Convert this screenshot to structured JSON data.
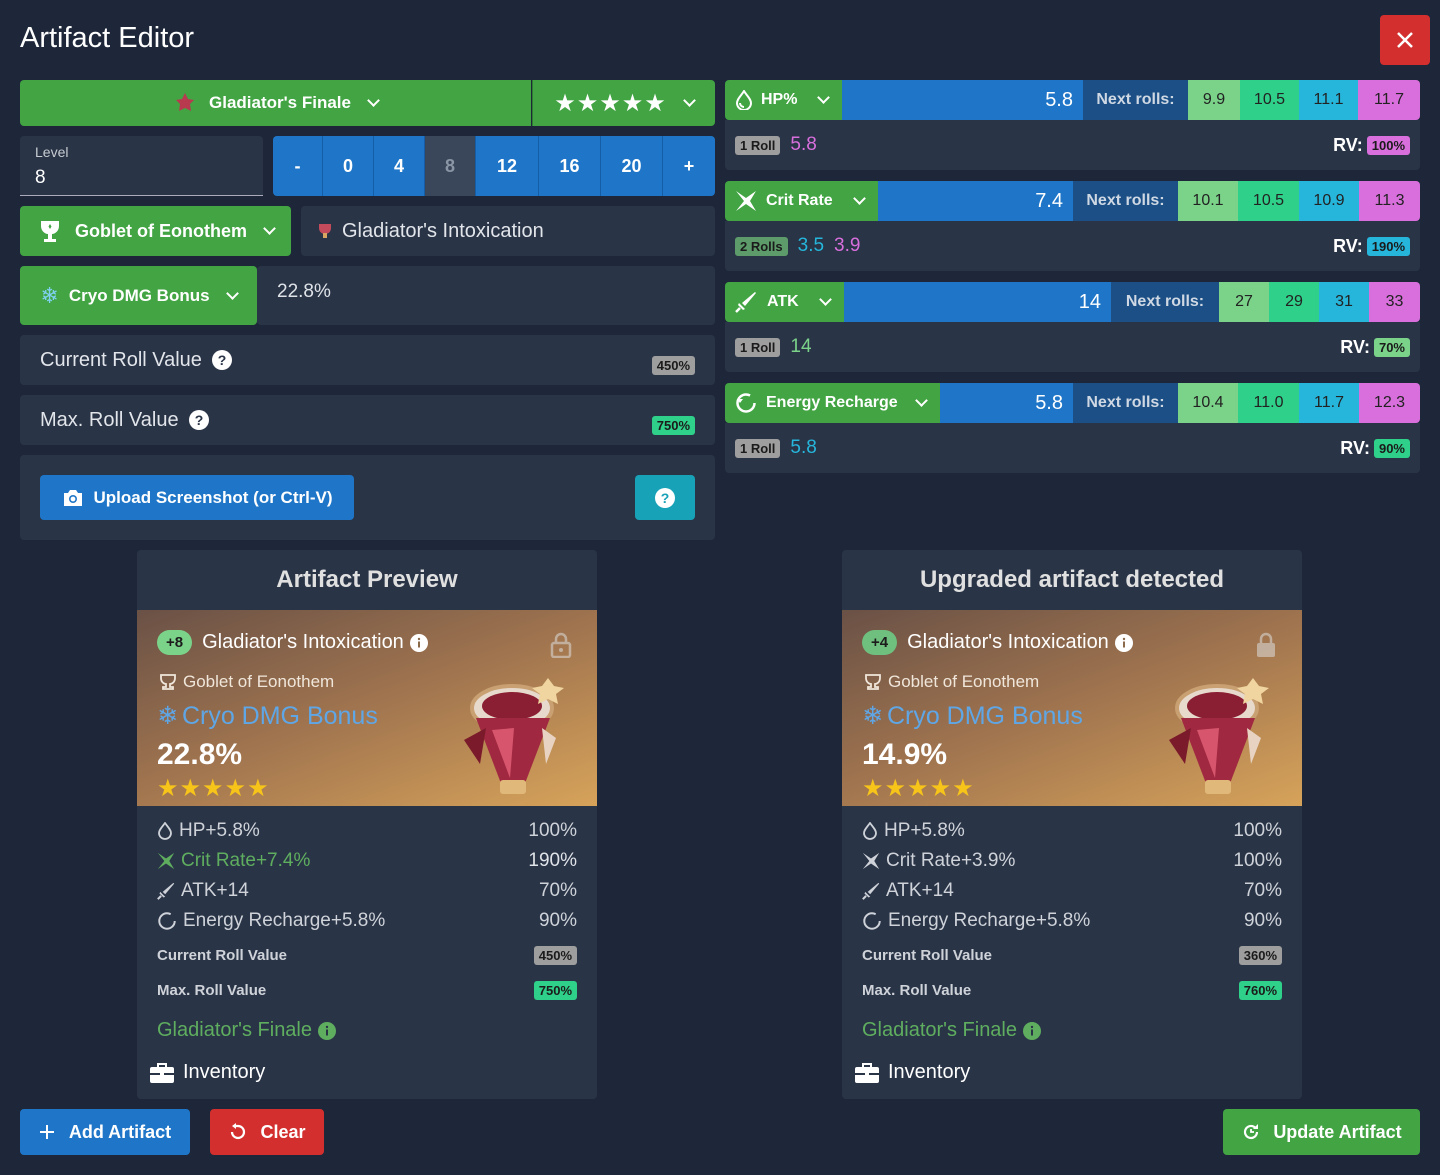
{
  "window": {
    "title": "Artifact Editor"
  },
  "set": {
    "name": "Gladiator's Finale",
    "stars": "★★★★★"
  },
  "level": {
    "label": "Level",
    "value": "8",
    "buttons": [
      "-",
      "0",
      "4",
      "8",
      "12",
      "16",
      "20",
      "+"
    ]
  },
  "slot": {
    "name": "Goblet of Eonothem",
    "piece_name": "Gladiator's Intoxication"
  },
  "main_stat": {
    "name": "Cryo DMG Bonus",
    "value": "22.8%"
  },
  "roll_values": {
    "current_label": "Current Roll Value",
    "current_value": "450%",
    "max_label": "Max. Roll Value",
    "max_value": "750%"
  },
  "upload": {
    "label": "Upload Screenshot (or Ctrl-V)"
  },
  "substats": [
    {
      "name": "HP%",
      "value": "5.8",
      "next_label": "Next rolls:",
      "rolls": [
        "9.9",
        "10.5",
        "11.1",
        "11.7"
      ],
      "roll_count": "1 Roll",
      "roll_values": [
        "5.8"
      ],
      "rv_label": "RV:",
      "rv": "100%",
      "fill": 0.5
    },
    {
      "name": "Crit Rate",
      "value": "7.4",
      "next_label": "Next rolls:",
      "rolls": [
        "10.1",
        "10.5",
        "10.9",
        "11.3"
      ],
      "roll_count": "2 Rolls",
      "roll_values": [
        "3.5",
        "3.9"
      ],
      "rv_label": "RV:",
      "rv": "190%",
      "fill": 0.5
    },
    {
      "name": "ATK",
      "value": "14",
      "next_label": "Next rolls:",
      "rolls": [
        "27",
        "29",
        "31",
        "33"
      ],
      "roll_count": "1 Roll",
      "roll_values": [
        "14"
      ],
      "rv_label": "RV:",
      "rv": "70%",
      "fill": 0.5
    },
    {
      "name": "Energy Recharge",
      "value": "5.8",
      "next_label": "Next rolls:",
      "rolls": [
        "10.4",
        "11.0",
        "11.7",
        "12.3"
      ],
      "roll_count": "1 Roll",
      "roll_values": [
        "5.8"
      ],
      "rv_label": "RV:",
      "rv": "90%",
      "fill": 0.5
    }
  ],
  "preview": {
    "header": "Artifact Preview",
    "level": "+8",
    "name": "Gladiator's Intoxication",
    "slot": "Goblet of Eonothem",
    "main_stat": "Cryo DMG Bonus",
    "main_value": "22.8%",
    "stars": "★★★★★",
    "stats": [
      {
        "text": "HP+5.8%",
        "val": "100%"
      },
      {
        "text": "Crit Rate+7.4%",
        "val": "190%"
      },
      {
        "text": "ATK+14",
        "val": "70%"
      },
      {
        "text": "Energy Recharge+5.8%",
        "val": "90%"
      }
    ],
    "current_label": "Current Roll Value",
    "current_value": "450%",
    "max_label": "Max. Roll Value",
    "max_value": "750%",
    "set": "Gladiator's Finale",
    "location": "Inventory"
  },
  "upgraded": {
    "header": "Upgraded artifact detected",
    "level": "+4",
    "name": "Gladiator's Intoxication",
    "slot": "Goblet of Eonothem",
    "main_stat": "Cryo DMG Bonus",
    "main_value": "14.9%",
    "stars": "★★★★★",
    "stats": [
      {
        "text": "HP+5.8%",
        "val": "100%"
      },
      {
        "text": "Crit Rate+3.9%",
        "val": "100%"
      },
      {
        "text": "ATK+14",
        "val": "70%"
      },
      {
        "text": "Energy Recharge+5.8%",
        "val": "90%"
      }
    ],
    "current_label": "Current Roll Value",
    "current_value": "360%",
    "max_label": "Max. Roll Value",
    "max_value": "760%",
    "set": "Gladiator's Finale",
    "location": "Inventory"
  },
  "footer": {
    "add": "Add Artifact",
    "clear": "Clear",
    "update": "Update Artifact"
  },
  "colors": {
    "accent_green": "#42a443",
    "accent_blue": "#1f76c8",
    "danger": "#d32f2f",
    "cyan": "#26b6dc",
    "pink": "#d96fdc"
  }
}
